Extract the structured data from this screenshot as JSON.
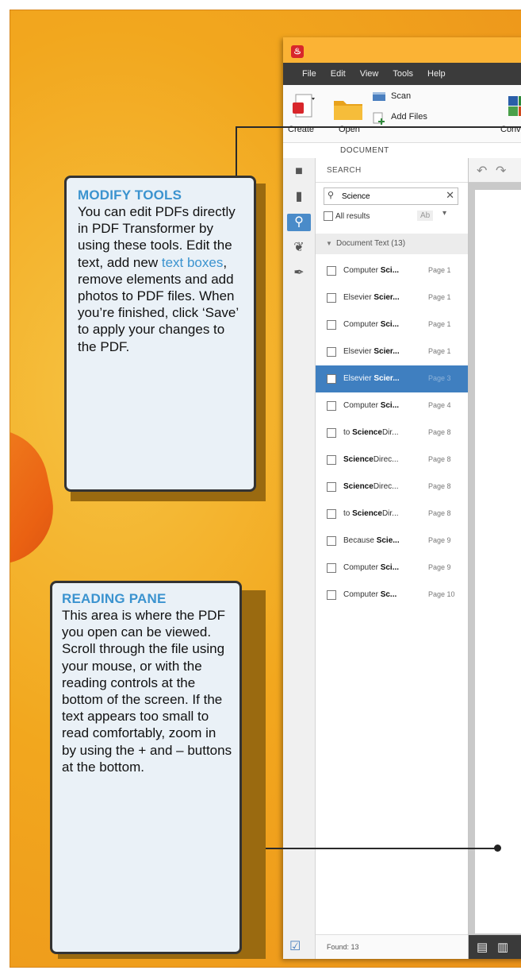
{
  "app": {
    "logo_glyph": "♨",
    "menu": [
      "File",
      "Edit",
      "View",
      "Tools",
      "Help"
    ],
    "ribbon": {
      "create": "Create",
      "open": "Open",
      "scan": "Scan",
      "add_files": "Add Files",
      "convert": "Conve"
    },
    "section_label": "DOCUMENT",
    "panel_title": "SEARCH",
    "search_value": "Science",
    "all_results": "All results",
    "ab_label": "Ab",
    "group": "Document Text (13)",
    "results": [
      {
        "pre": "Computer ",
        "bold": "Sci...",
        "post": "",
        "page": "Page 1",
        "selected": false
      },
      {
        "pre": "Elsevier ",
        "bold": "Scier...",
        "post": "",
        "page": "Page 1",
        "selected": false
      },
      {
        "pre": "Computer ",
        "bold": "Sci...",
        "post": "",
        "page": "Page 1",
        "selected": false
      },
      {
        "pre": "Elsevier ",
        "bold": "Scier...",
        "post": "",
        "page": "Page 1",
        "selected": false
      },
      {
        "pre": "Elsevier ",
        "bold": "Scier...",
        "post": "",
        "page": "Page 3",
        "selected": true
      },
      {
        "pre": "Computer ",
        "bold": "Sci...",
        "post": "",
        "page": "Page 4",
        "selected": false
      },
      {
        "pre": "to ",
        "bold": "Science",
        "post": "Dir...",
        "page": "Page 8",
        "selected": false
      },
      {
        "pre": "",
        "bold": "Science",
        "post": "Direc...",
        "page": "Page 8",
        "selected": false
      },
      {
        "pre": "",
        "bold": "Science",
        "post": "Direc...",
        "page": "Page 8",
        "selected": false
      },
      {
        "pre": "to ",
        "bold": "Science",
        "post": "Dir...",
        "page": "Page 8",
        "selected": false
      },
      {
        "pre": "Because ",
        "bold": "Scie...",
        "post": "",
        "page": "Page 9",
        "selected": false
      },
      {
        "pre": "Computer ",
        "bold": "Sci...",
        "post": "",
        "page": "Page 9",
        "selected": false
      },
      {
        "pre": "Computer ",
        "bold": "Sc...",
        "post": "",
        "page": "Page 10",
        "selected": false
      }
    ],
    "found": "Found: 13"
  },
  "callout_modify": {
    "title": "MODIFY TOOLS",
    "body_1": "You can edit PDFs directly in PDF Transformer by using these tools. Edit the text, add new ",
    "highlight": "text boxes",
    "body_2": ", remove elements and add photos to PDF files. When you’re finished, click ‘Save’ to apply your changes to the PDF."
  },
  "callout_reading": {
    "title": "READING PANE",
    "body": "This area is where the PDF you open can be viewed. Scroll through the file using your mouse, or with the reading controls at the bottom of the screen. If the text appears too small to read comfortably, zoom in by using the + and – buttons at the bottom."
  },
  "colors": {
    "background": "#f2a71e",
    "accent": "#3b93cf",
    "selection": "#3f7fc0",
    "titlebar": "#fbb335",
    "menubar": "#3b3b3b"
  }
}
